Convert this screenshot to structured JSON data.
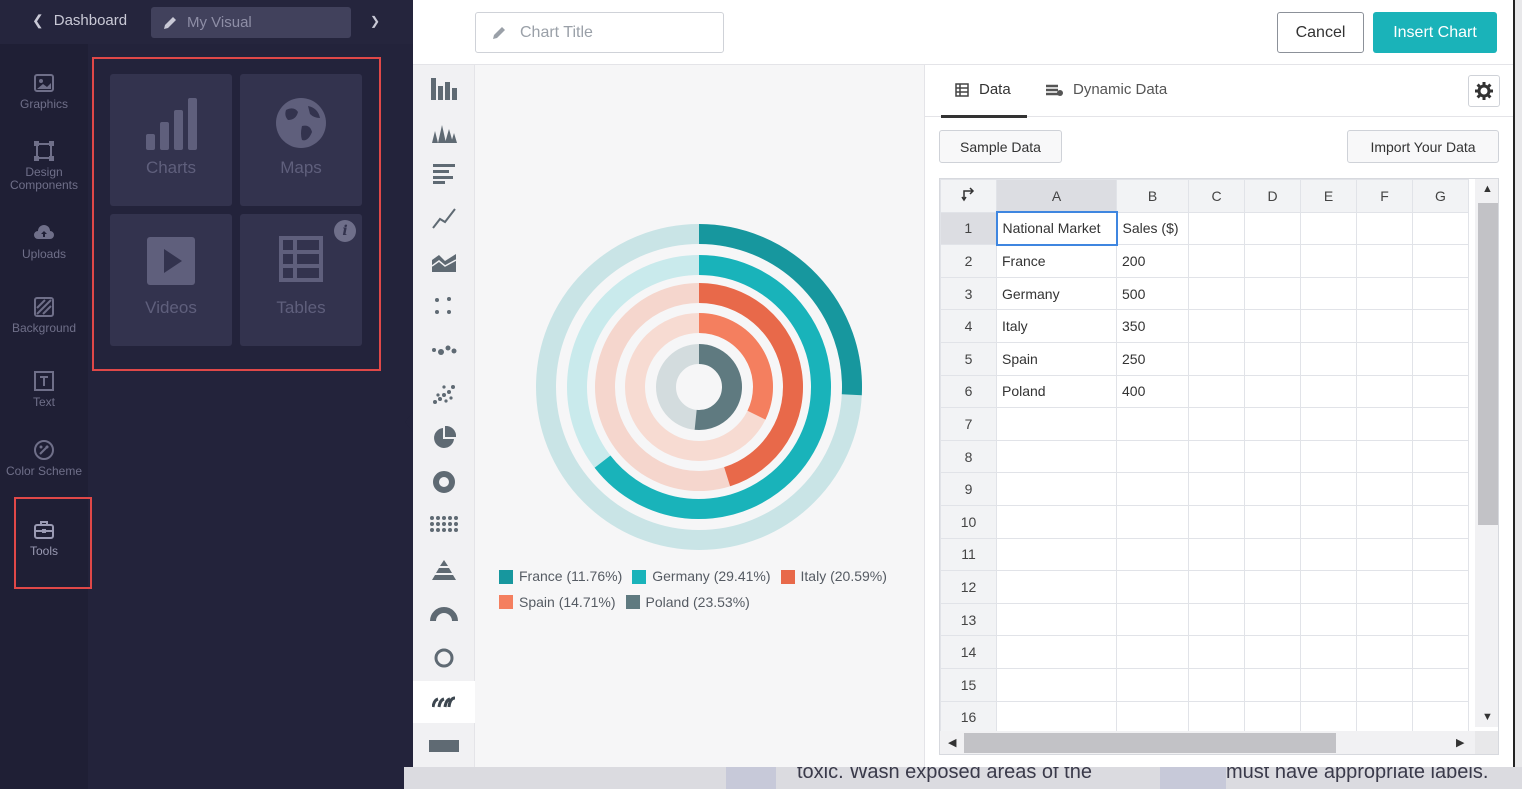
{
  "topbar": {
    "back_label": "Dashboard",
    "visual_name": "My Visual"
  },
  "leftnav": {
    "items": [
      {
        "label": "Graphics",
        "icon": "image-icon"
      },
      {
        "label": "Design Components",
        "icon": "frame-icon"
      },
      {
        "label": "Uploads",
        "icon": "cloud-upload-icon"
      },
      {
        "label": "Background",
        "icon": "hatch-icon"
      },
      {
        "label": "Text",
        "icon": "text-box-icon"
      },
      {
        "label": "Color Scheme",
        "icon": "palette-icon"
      },
      {
        "label": "Tools",
        "icon": "toolbox-icon"
      }
    ]
  },
  "gallery": {
    "tiles": [
      {
        "label": "Charts",
        "icon": "bar-chart-icon"
      },
      {
        "label": "Maps",
        "icon": "globe-icon"
      },
      {
        "label": "Videos",
        "icon": "play-icon"
      },
      {
        "label": "Tables",
        "icon": "table-icon"
      }
    ]
  },
  "modal": {
    "title_placeholder": "Chart Title",
    "cancel_label": "Cancel",
    "insert_label": "Insert Chart",
    "tabs": [
      {
        "label": "Data",
        "icon": "grid-icon"
      },
      {
        "label": "Dynamic Data",
        "icon": "database-icon"
      }
    ],
    "sample_label": "Sample Data",
    "import_label": "Import Your Data"
  },
  "chart_types": [
    "bar",
    "column-peaks",
    "horizontal-bar",
    "line",
    "area",
    "scatter",
    "bubble",
    "dot-scatter",
    "pie",
    "donut",
    "dot-matrix",
    "pyramid",
    "gauge",
    "ring",
    "radial",
    "progress-bar"
  ],
  "chart_data": {
    "type": "radial",
    "categories": [
      "France",
      "Germany",
      "Italy",
      "Spain",
      "Poland"
    ],
    "values": [
      200,
      500,
      350,
      250,
      400
    ],
    "legend": [
      "France (11.76%)",
      "Germany (29.41%)",
      "Italy (20.59%)",
      "Spain (14.71%)",
      "Poland (23.53%)"
    ],
    "colors": [
      "#17979e",
      "#19b3ba",
      "#e8694a",
      "#f47f5f",
      "#5f7a80"
    ],
    "track_colors": [
      "#c9e4e6",
      "#c9eaec",
      "#f5d6cd",
      "#f7dbd2",
      "#d3dcde"
    ]
  },
  "sheet": {
    "columns": [
      "A",
      "B",
      "C",
      "D",
      "E",
      "F",
      "G"
    ],
    "rows": [
      [
        "National Market",
        "Sales ($)"
      ],
      [
        "France",
        "200"
      ],
      [
        "Germany",
        "500"
      ],
      [
        "Italy",
        "350"
      ],
      [
        "Spain",
        "250"
      ],
      [
        "Poland",
        "400"
      ],
      [],
      [],
      [],
      [],
      [],
      [],
      [],
      [],
      [],
      []
    ],
    "row_numbers": [
      "1",
      "2",
      "3",
      "4",
      "5",
      "6",
      "7",
      "8",
      "9",
      "10",
      "11",
      "12",
      "13",
      "14",
      "15",
      "16"
    ]
  },
  "backdrop": {
    "left_text": "toxic. Wash exposed areas of the",
    "right_text": "must have appropriate labels."
  }
}
